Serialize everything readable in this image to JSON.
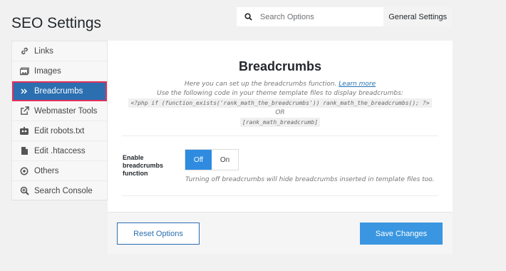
{
  "page": {
    "title": "SEO Settings"
  },
  "search": {
    "placeholder": "Search Options",
    "scope": "General Settings"
  },
  "sidebar": {
    "items": [
      {
        "label": "Links",
        "icon": "link-icon"
      },
      {
        "label": "Images",
        "icon": "image-icon"
      },
      {
        "label": "Breadcrumbs",
        "icon": "breadcrumbs-icon",
        "active": true
      },
      {
        "label": "Webmaster Tools",
        "icon": "external-link-icon"
      },
      {
        "label": "Edit robots.txt",
        "icon": "robot-icon"
      },
      {
        "label": "Edit .htaccess",
        "icon": "file-icon"
      },
      {
        "label": "Others",
        "icon": "target-icon"
      },
      {
        "label": "Search Console",
        "icon": "search-console-icon"
      }
    ]
  },
  "panel": {
    "title": "Breadcrumbs",
    "desc_line1": "Here you can set up the breadcrumbs function.",
    "learn_more": "Learn more",
    "desc_line2": "Use the following code in your theme template files to display breadcrumbs:",
    "code_php": "<?php if (function_exists('rank_math_the_breadcrumbs')) rank_math_the_breadcrumbs(); ?>",
    "or_text": "OR",
    "code_shortcode": "[rank_math_breadcrumb]",
    "field_label": "Enable breadcrumbs function",
    "toggle_off": "Off",
    "toggle_on": "On",
    "toggle_state": "Off",
    "field_desc": "Turning off breadcrumbs will hide breadcrumbs inserted in template files too."
  },
  "footer": {
    "reset_label": "Reset Options",
    "save_label": "Save Changes"
  },
  "colors": {
    "accent": "#2b6fb1",
    "active_border": "#e0315b",
    "toggle_on": "#2f8be0",
    "save_button": "#3a96e0"
  }
}
